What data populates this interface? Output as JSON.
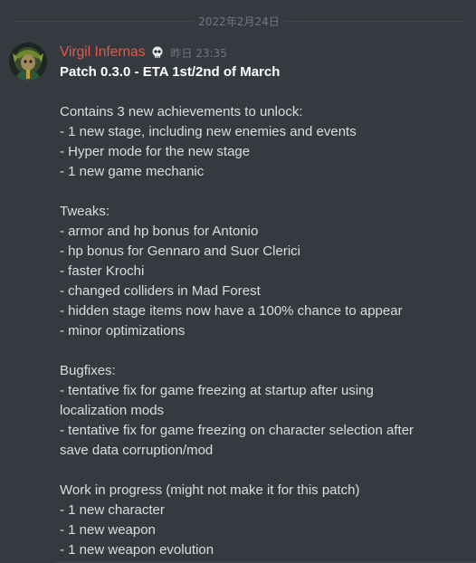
{
  "date_divider": "2022年2月24日",
  "message": {
    "author": "Virgil Infernas",
    "author_color": "#e35a4b",
    "badge_icon": "skull-badge-icon",
    "timestamp": "昨日 23:35",
    "title": "Patch 0.3.0 - ETA 1st/2nd of March",
    "intro": "Contains 3 new achievements to unlock:",
    "new_items": [
      "- 1 new stage, including new enemies and events",
      "- Hyper mode for the new stage",
      "- 1 new game mechanic"
    ],
    "tweaks_heading": "Tweaks:",
    "tweaks": [
      "- armor and hp bonus for Antonio",
      "- hp bonus for Gennaro and Suor Clerici",
      "- faster Krochi",
      "- changed colliders in Mad Forest",
      "- hidden stage items now have a 100% chance to appear",
      "- minor optimizations"
    ],
    "bugfixes_heading": "Bugfixes:",
    "bugfixes": [
      "- tentative fix for game freezing at startup after using",
      "localization mods",
      "- tentative fix for game freezing on character selection after",
      "save data corruption/mod"
    ],
    "wip_heading": "Work in progress (might not make it for this patch)",
    "wip": [
      "- 1 new character",
      "- 1 new weapon",
      "- 1 new weapon evolution"
    ]
  }
}
